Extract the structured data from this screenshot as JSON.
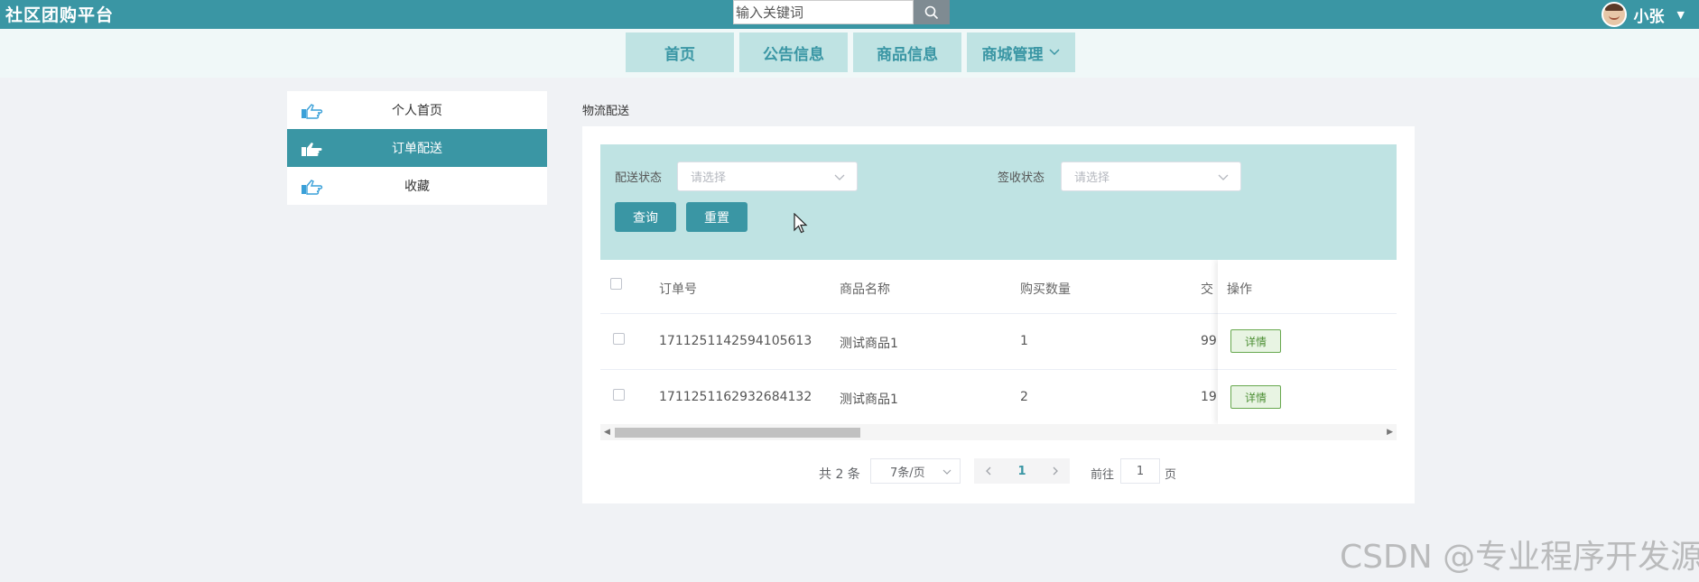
{
  "header": {
    "site_title": "社区团购平台",
    "search_placeholder": "输入关键词",
    "username": "小张",
    "brand_color": "#3a96a4"
  },
  "nav": {
    "items": [
      {
        "label": "首页"
      },
      {
        "label": "公告信息"
      },
      {
        "label": "商品信息"
      },
      {
        "label": "商城管理"
      }
    ]
  },
  "sidebar": {
    "items": [
      {
        "label": "个人首页",
        "active": false
      },
      {
        "label": "订单配送",
        "active": true
      },
      {
        "label": "收藏",
        "active": false
      }
    ]
  },
  "main": {
    "breadcrumb": "物流配送",
    "filters": {
      "delivery_status_label": "配送状态",
      "delivery_status_placeholder": "请选择",
      "sign_status_label": "签收状态",
      "sign_status_placeholder": "请选择",
      "query_button": "查询",
      "reset_button": "重置"
    },
    "table": {
      "headers": [
        "订单号",
        "商品名称",
        "购买数量",
        "交",
        "操作"
      ],
      "rows": [
        {
          "order_no": "1711251142594105613",
          "product": "测试商品1",
          "qty": "1",
          "amount_partial": "99",
          "action": "详情"
        },
        {
          "order_no": "1711251162932684132",
          "product": "测试商品1",
          "qty": "2",
          "amount_partial": "19",
          "action": "详情"
        }
      ]
    },
    "pagination": {
      "total_text": "共 2 条",
      "page_size": "7条/页",
      "current_page": "1",
      "goto_prefix": "前往",
      "goto_value": "1",
      "goto_suffix": "页"
    }
  },
  "watermark": "CSDN @专业程序开发源"
}
